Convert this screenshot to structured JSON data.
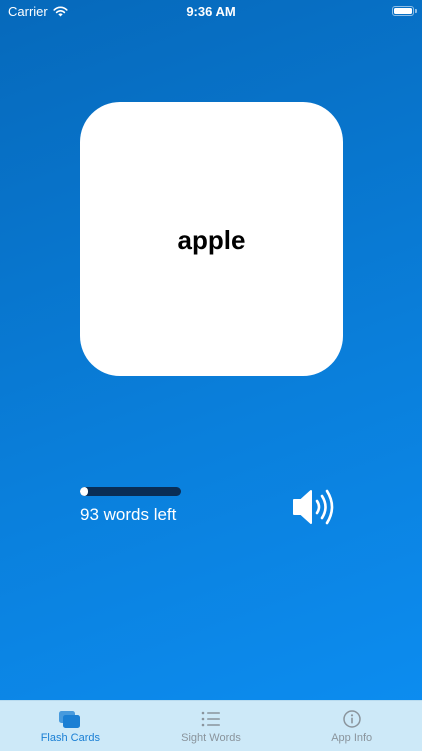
{
  "status_bar": {
    "carrier": "Carrier",
    "time": "9:36 AM",
    "wifi_icon": "wifi-icon",
    "battery_icon": "battery-icon"
  },
  "card": {
    "word": "apple"
  },
  "progress": {
    "fraction_complete": 0.02,
    "words_left_text": "93 words left"
  },
  "speaker": {
    "icon": "speaker-icon"
  },
  "tab_bar": {
    "active_color": "#1a7fd4",
    "inactive_color": "#8a949c",
    "tabs": [
      {
        "label": "Flash Cards",
        "icon": "flash-cards-icon",
        "active": true
      },
      {
        "label": "Sight Words",
        "icon": "list-icon",
        "active": false
      },
      {
        "label": "App Info",
        "icon": "info-icon",
        "active": false
      }
    ]
  },
  "colors": {
    "background_top": "#0669bb",
    "background_bottom": "#0d8ef2",
    "card": "#ffffff",
    "progress_track": "#0a2d55"
  }
}
